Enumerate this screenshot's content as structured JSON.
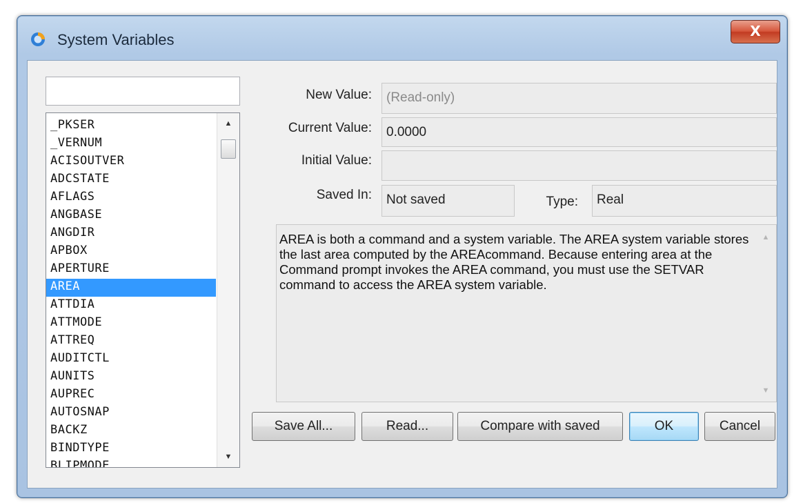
{
  "window": {
    "title": "System Variables",
    "close_label": "X"
  },
  "search": {
    "value": "",
    "placeholder": ""
  },
  "variables": {
    "items": [
      "_PKSER",
      "_VERNUM",
      "ACISOUTVER",
      "ADCSTATE",
      "AFLAGS",
      "ANGBASE",
      "ANGDIR",
      "APBOX",
      "APERTURE",
      "AREA",
      "ATTDIA",
      "ATTMODE",
      "ATTREQ",
      "AUDITCTL",
      "AUNITS",
      "AUPREC",
      "AUTOSNAP",
      "BACKZ",
      "BINDTYPE",
      "BLIPMODE"
    ],
    "selected": "AREA"
  },
  "labels": {
    "new_value": "New Value:",
    "current_value": "Current Value:",
    "initial_value": "Initial Value:",
    "saved_in": "Saved In:",
    "type": "Type:"
  },
  "values": {
    "new_value": "(Read-only)",
    "current_value": "0.0000",
    "initial_value": "",
    "saved_in": "Not saved",
    "type": "Real"
  },
  "description": "AREA is both a command and a system variable. The AREA system variable stores the last area computed by the AREAcommand. Because entering area at the Command prompt invokes the AREA command, you must use the SETVAR command to access the AREA system variable.",
  "buttons": {
    "save_all": "Save All...",
    "read": "Read...",
    "compare": "Compare with saved",
    "ok": "OK",
    "cancel": "Cancel"
  },
  "colors": {
    "selection": "#3399ff",
    "close_button": "#c23b22",
    "frame": "#a9c3e2"
  }
}
